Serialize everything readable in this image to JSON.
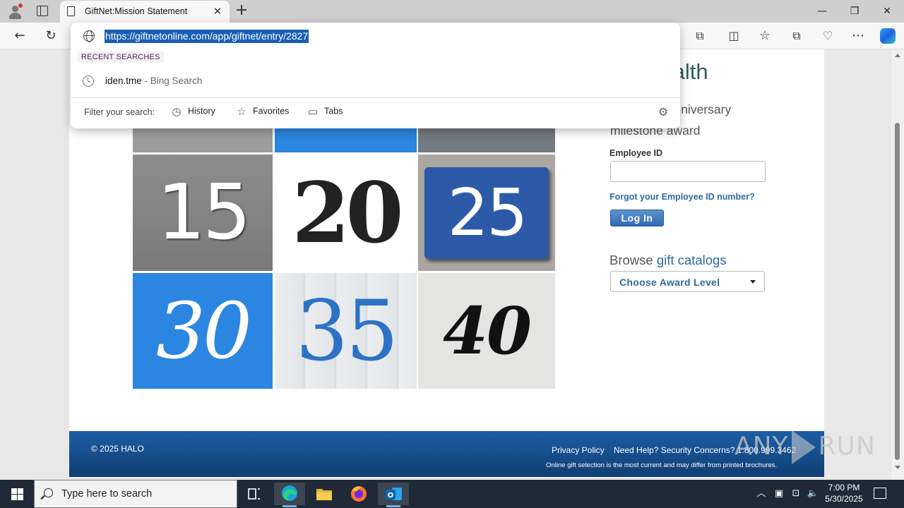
{
  "browser": {
    "tab_title": "GiftNet:Mission Statement",
    "tab_close": "✕",
    "new_tab": "+",
    "window_controls": {
      "minimize": "—",
      "maximize": "❐",
      "close": "✕"
    },
    "url": "https://giftnetonline.com/app/giftnet/entry/2827"
  },
  "omnibox": {
    "recent_label": "RECENT SEARCHES",
    "recent_items": [
      {
        "query": "iden.tme",
        "source": " - Bing Search"
      }
    ],
    "filter_label": "Filter your search:",
    "filters": [
      "History",
      "Favorites",
      "Tabs"
    ]
  },
  "page": {
    "brand": "aceHealth",
    "instruction": "elect your anniversary milestone award",
    "employee_id_label": "Employee ID",
    "employee_id_value": "",
    "forgot_link": "Forgot your Employee ID number?",
    "login_button": "Log In",
    "browse_prefix": "Browse ",
    "browse_link": "gift catalogs",
    "award_select": "Choose Award Level",
    "milestones": [
      "15",
      "20",
      "25",
      "30",
      "35",
      "40"
    ]
  },
  "footer": {
    "copyright": "© 2025 HALO",
    "privacy": "Privacy Policy",
    "help": "Need Help? Security Concerns? 1.800.999.3462",
    "disclaimer": "Online gift selection is the most current and may differ from printed brochures."
  },
  "watermark": {
    "left": "ANY",
    "right": "RUN"
  },
  "taskbar": {
    "search_placeholder": "Type here to search",
    "time": "7:00 PM",
    "date": "5/30/2025"
  },
  "colors": {
    "link_blue": "#2f6a9f",
    "footer_blue": "#1c5ea3",
    "url_highlight": "#1a5fb4",
    "brand_teal": "#2e5c61"
  }
}
